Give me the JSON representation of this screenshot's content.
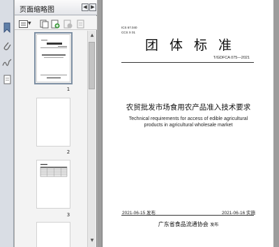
{
  "panel": {
    "title": "页面缩略图",
    "prev_label": "◀",
    "next_label": "▶",
    "thumbnails": [
      {
        "page": "1"
      },
      {
        "page": "2"
      },
      {
        "page": "3"
      }
    ]
  },
  "document": {
    "ics": "ICS 67.040",
    "ccs": "CCS X 01",
    "standard_type": "团体标准",
    "standard_number": "T/GDFCA 075—2021",
    "title_cn": "农贸批发市场食用农产品准入技术要求",
    "title_en_line1": "Technical requirements for access of edible agricultural",
    "title_en_line2": "products in agricultural wholesale market",
    "issue_date": "2021-06-15 发布",
    "implement_date": "2021-06-16 实施",
    "publisher": "广东省食品流通协会",
    "publisher_suffix": "发布"
  },
  "colors": {
    "rail_bg": "#d9dde4",
    "panel_bg": "#f3f3f3",
    "doc_bg": "#9d9d9d",
    "thumb_selected_outline": "#7d8fa3"
  },
  "icons": {
    "rail": [
      "bookmark-icon",
      "attachment-icon",
      "signature-icon",
      "pages-icon"
    ],
    "toolbar": [
      "options-icon",
      "copy-pages-icon",
      "insert-pages-icon",
      "delete-pages-icon",
      "print-pages-icon"
    ]
  }
}
